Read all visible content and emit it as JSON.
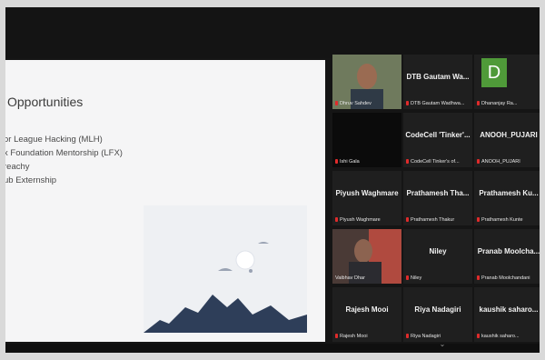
{
  "slide": {
    "title": "Opportunities",
    "items": [
      "or League Hacking (MLH)",
      "x Foundation Mentorship (LFX)",
      "reachy",
      "ub Externship"
    ]
  },
  "gallery": {
    "tiles": [
      {
        "name": "",
        "label": "Dhruv Sahdev",
        "video": "person-green-wall",
        "active": true
      },
      {
        "name": "DTB Gautam Wa...",
        "label": "DTB Gautam Wadhwa..."
      },
      {
        "name": "D",
        "label": "Dhananjay Ra...",
        "avatar": true
      },
      {
        "name": "",
        "label": "Ishi Gala",
        "video": "dark"
      },
      {
        "name": "CodeCell 'Tinker'...",
        "label": "CodeCell Tinker's of..."
      },
      {
        "name": "ANOOH_PUJARI",
        "label": "ANOOH_PUJARI"
      },
      {
        "name": "Piyush Waghmare",
        "label": "Piyush Waghmare"
      },
      {
        "name": "Prathamesh Tha...",
        "label": "Prathamesh Thakur"
      },
      {
        "name": "Prathamesh Ku...",
        "label": "Prathamesh Kunte"
      },
      {
        "name": "",
        "label": "Vaibhav Dhar",
        "video": "person-red-wall"
      },
      {
        "name": "Niley",
        "label": "Niley"
      },
      {
        "name": "Pranab Moolcha...",
        "label": "Pranab Moolchandani"
      },
      {
        "name": "Rajesh Mooi",
        "label": "Rajesh Mooi"
      },
      {
        "name": "Riya Nadagiri",
        "label": "Riya Nadagiri"
      },
      {
        "name": "kaushik saharo...",
        "label": "kaushik saharo..."
      }
    ]
  },
  "colors": {
    "active_outline": "#c6d54a",
    "muted_mic": "#e02b2b",
    "avatar_green": "#4f9a39",
    "mountain": "#2e3e59"
  }
}
